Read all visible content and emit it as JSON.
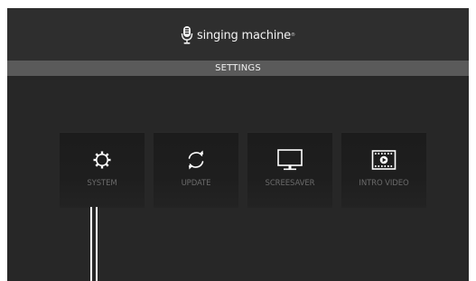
{
  "header": {
    "brand": "singing machine",
    "trademark": "®",
    "logo_icon": "microphone-icon"
  },
  "title_bar": {
    "label": "SETTINGS"
  },
  "menu": {
    "items": [
      {
        "label": "SYSTEM",
        "icon": "gear-icon"
      },
      {
        "label": "UPDATE",
        "icon": "refresh-icon"
      },
      {
        "label": "SCREESAVER",
        "icon": "monitor-icon"
      },
      {
        "label": "INTRO VIDEO",
        "icon": "film-play-icon"
      }
    ]
  },
  "colors": {
    "background": "#272727",
    "header_bar": "#2e2e2e",
    "title_bar": "#5a5a5a",
    "tile": "#1e1e1e",
    "tile_label": "#6b6b6b",
    "icon": "#ffffff"
  }
}
